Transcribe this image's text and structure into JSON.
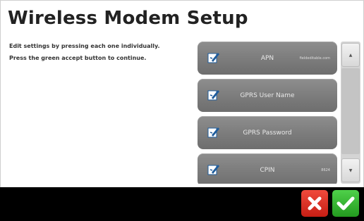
{
  "page": {
    "title": "Wireless Modem Setup"
  },
  "instructions": {
    "line1": "Edit settings by pressing each one individually.",
    "line2": "Press the green accept button to continue."
  },
  "settings": [
    {
      "label": "APN",
      "value": "fieldeditable.com",
      "icon": "edit-icon"
    },
    {
      "label": "GPRS User Name",
      "value": "",
      "icon": "edit-icon"
    },
    {
      "label": "GPRS Password",
      "value": "",
      "icon": "edit-icon"
    },
    {
      "label": "CPIN",
      "value": "8624",
      "icon": "edit-icon"
    }
  ],
  "scrollbar": {
    "up_icon": "▲",
    "down_icon": "▼"
  },
  "actions": {
    "cancel_icon": "close-icon",
    "accept_icon": "check-icon"
  },
  "colors": {
    "button_gray": "#7d7d7d",
    "cancel_red": "#d42a1e",
    "accept_green": "#33b52e",
    "bottom_bar": "#000000"
  }
}
